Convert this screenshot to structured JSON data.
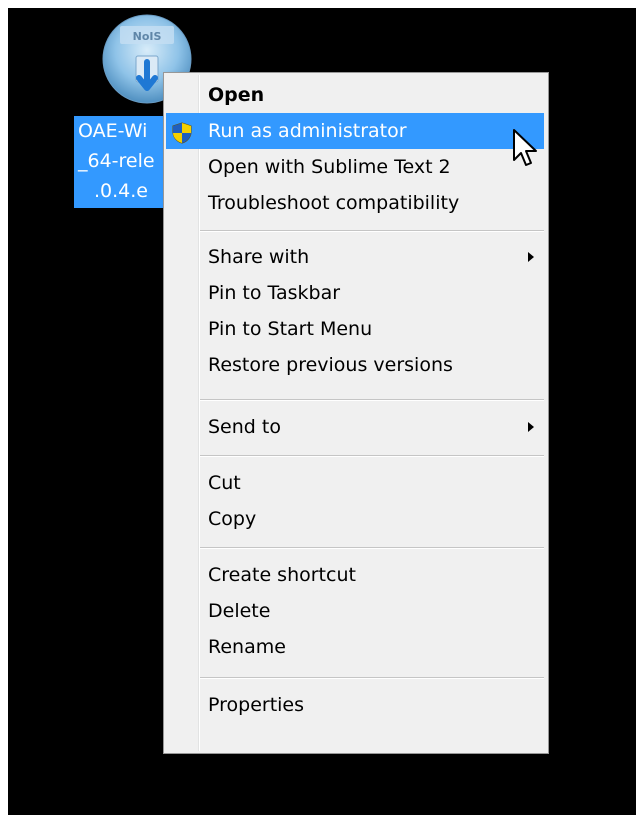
{
  "desktop": {
    "file": {
      "icon": "installer-disc-icon",
      "icon_text": "NoIS",
      "label_lines": [
        "OAE-Wi",
        "_64-rele",
        ".0.4.e"
      ]
    }
  },
  "context_menu": {
    "items": [
      {
        "label": "Open",
        "bold": true
      },
      {
        "label": "Run as administrator",
        "icon": "uac-shield-icon",
        "highlighted": true
      },
      {
        "label": "Open with Sublime Text 2"
      },
      {
        "label": "Troubleshoot compatibility"
      },
      {
        "label": "Share with",
        "submenu": true
      },
      {
        "label": "Pin to Taskbar"
      },
      {
        "label": "Pin to Start Menu"
      },
      {
        "label": "Restore previous versions"
      },
      {
        "label": "Send to",
        "submenu": true
      },
      {
        "label": "Cut"
      },
      {
        "label": "Copy"
      },
      {
        "label": "Create shortcut"
      },
      {
        "label": "Delete"
      },
      {
        "label": "Rename"
      },
      {
        "label": "Properties"
      }
    ]
  },
  "colors": {
    "highlight": "#3399ff",
    "menu_background": "#f0f0f0",
    "desktop_background": "#000000"
  }
}
